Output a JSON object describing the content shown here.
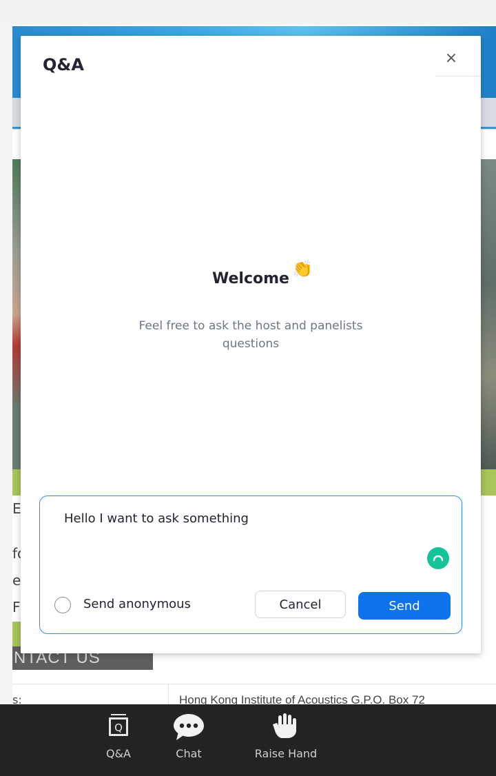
{
  "background_page": {
    "contact_heading": "NTACT US",
    "address_text": "Hong Kong Institute of Acoustics G.P.O. Box 72",
    "left_fragment": "s:",
    "side_letters": [
      "E",
      "fo",
      "e",
      "F"
    ]
  },
  "dialog": {
    "title": "Q&A",
    "close_glyph": "×",
    "welcome_title": "Welcome",
    "welcome_emoji": "👏",
    "welcome_subtitle": "Feel free to ask the host and panelists questions",
    "compose": {
      "text": "Hello I want to ask something",
      "anonymous_label": "Send anonymous",
      "anonymous_checked": false,
      "cancel_label": "Cancel",
      "send_label": "Send"
    }
  },
  "toolbar": {
    "items": [
      {
        "label": "Q&A",
        "icon": "qa-icon"
      },
      {
        "label": "Chat",
        "icon": "chat-icon"
      },
      {
        "label": "Raise Hand",
        "icon": "raise-hand-icon"
      }
    ]
  },
  "colors": {
    "accent": "#0e72ed",
    "focus_border": "#2d8cff",
    "toolbar_bg": "#232323",
    "grammarly": "#15c39a"
  }
}
